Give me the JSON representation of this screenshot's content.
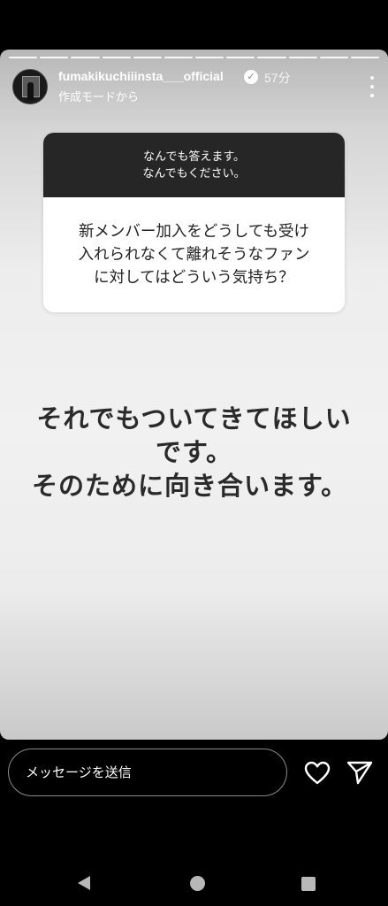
{
  "story": {
    "username": "fumakikuchiiinsta___official",
    "verified_icon": "verified-badge-icon",
    "time": "57分",
    "subtitle": "作成モードから",
    "segments": 12
  },
  "question": {
    "header_line1": "なんでも答えます。",
    "header_line2": "なんでもください。",
    "body_line1": "新メンバー加入をどうしても受け",
    "body_line2": "入れられなくて離れそうなファン",
    "body_line3": "に対してはどういう気持ち？"
  },
  "answer": {
    "line1": "それでもついてきてほしい",
    "line2": "です。",
    "line3": "そのために向き合います。"
  },
  "reply": {
    "placeholder": "メッセージを送信"
  },
  "colors": {
    "question_header_bg": "#262626",
    "answer_text": "#2a2a2a",
    "background": "#000000"
  }
}
